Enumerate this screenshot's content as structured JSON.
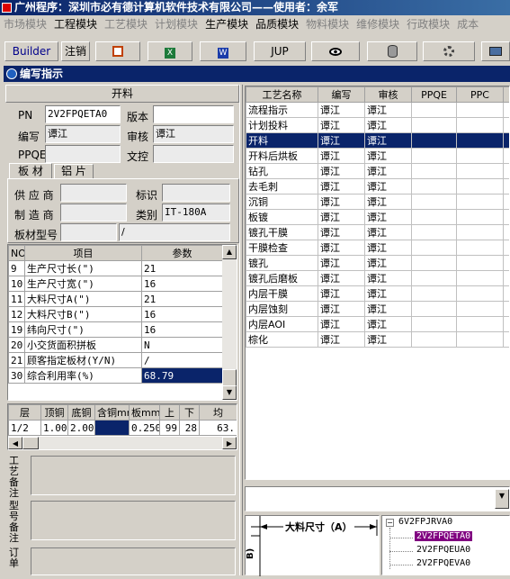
{
  "window": {
    "title": "广州程序：深圳市必有德计算机软件技术有限公司——使用者：余军"
  },
  "menu": [
    "市场模块",
    "工程模块",
    "工艺模块",
    "计划模块",
    "生产模块",
    "品质模块",
    "物料模块",
    "维修模块",
    "行政模块",
    "成本"
  ],
  "menu_disabled": [
    true,
    false,
    true,
    true,
    false,
    false,
    true,
    true,
    true,
    true
  ],
  "toolbar": {
    "builder": "Builder",
    "logout": "注销",
    "jup": "JUP"
  },
  "panel": {
    "title": "编写指示"
  },
  "process": {
    "header": "开料",
    "pn_label": "PN",
    "pn_value": "2V2FPQETA0",
    "version_label": "版本",
    "version_value": "",
    "author_label": "编写",
    "author_value": "谭江",
    "review_label": "审核",
    "review_value": "谭江",
    "ppqe_label": "PPQE",
    "ppqe_value": "",
    "doc_label": "文控",
    "doc_value": ""
  },
  "tabs": [
    "板 材",
    "铝 片"
  ],
  "board": {
    "supplier_label": "供 应 商",
    "supplier_value": "",
    "mark_label": "标识",
    "mark_value": "",
    "maker_label": "制 造 商",
    "maker_value": "",
    "category_label": "类别",
    "category_value": "IT-180A",
    "model_label": "板材型号",
    "model_value": "",
    "model_suffix": "/"
  },
  "params": {
    "headers": [
      "NO",
      "项目",
      "参数"
    ],
    "rows": [
      [
        "9",
        "生产尺寸长(\")",
        "21"
      ],
      [
        "10",
        "生产尺寸宽(\")",
        "16"
      ],
      [
        "11",
        "大料尺寸A(\")",
        "21"
      ],
      [
        "12",
        "大料尺寸B(\")",
        "16"
      ],
      [
        "19",
        "纬向尺寸(\")",
        "16"
      ],
      [
        "20",
        "小交货面积拼板",
        "N"
      ],
      [
        "21",
        "顾客指定板材(Y/N)",
        "/"
      ],
      [
        "30",
        "综合利用率(%)",
        "68.79"
      ]
    ]
  },
  "layers": {
    "headers": [
      "层",
      "顶铜",
      "底铜",
      "含铜mm",
      "板mm",
      "上",
      "下",
      "均"
    ],
    "rows": [
      [
        "1/2",
        "1.00",
        "2.00",
        "",
        "0.250",
        "99",
        "28",
        "63."
      ]
    ]
  },
  "notes": {
    "craft_label": "工艺备注",
    "model_label": "型号备注",
    "order_label": "订单"
  },
  "processes": {
    "headers": [
      "工艺名称",
      "编写",
      "审核",
      "PPQE",
      "PPC"
    ],
    "rows": [
      [
        "流程指示",
        "谭江",
        "谭江"
      ],
      [
        "计划投料",
        "谭江",
        "谭江"
      ],
      [
        "开料",
        "谭江",
        "谭江"
      ],
      [
        "开料后烘板",
        "谭江",
        "谭江"
      ],
      [
        "钻孔",
        "谭江",
        "谭江"
      ],
      [
        "去毛刺",
        "谭江",
        "谭江"
      ],
      [
        "沉铜",
        "谭江",
        "谭江"
      ],
      [
        "板镀",
        "谭江",
        "谭江"
      ],
      [
        "镀孔干膜",
        "谭江",
        "谭江"
      ],
      [
        "干膜检查",
        "谭江",
        "谭江"
      ],
      [
        "镀孔",
        "谭江",
        "谭江"
      ],
      [
        "镀孔后磨板",
        "谭江",
        "谭江"
      ],
      [
        "内层干膜",
        "谭江",
        "谭江"
      ],
      [
        "内层蚀刻",
        "谭江",
        "谭江"
      ],
      [
        "内层AOI",
        "谭江",
        "谭江"
      ],
      [
        "棕化",
        "谭江",
        "谭江"
      ]
    ],
    "selected_index": 2
  },
  "diagram": {
    "a_label": "大料尺寸（A）",
    "b_label": "B)"
  },
  "tree": {
    "root": "6V2FPJRVA0",
    "children": [
      "2V2FPQETA0",
      "2V2FPQEUA0",
      "2V2FPQEVA0"
    ],
    "selected_index": 0
  },
  "colors": {
    "selection": "#0a246a",
    "tree_selection": "#800080",
    "title": "#0a246a"
  }
}
